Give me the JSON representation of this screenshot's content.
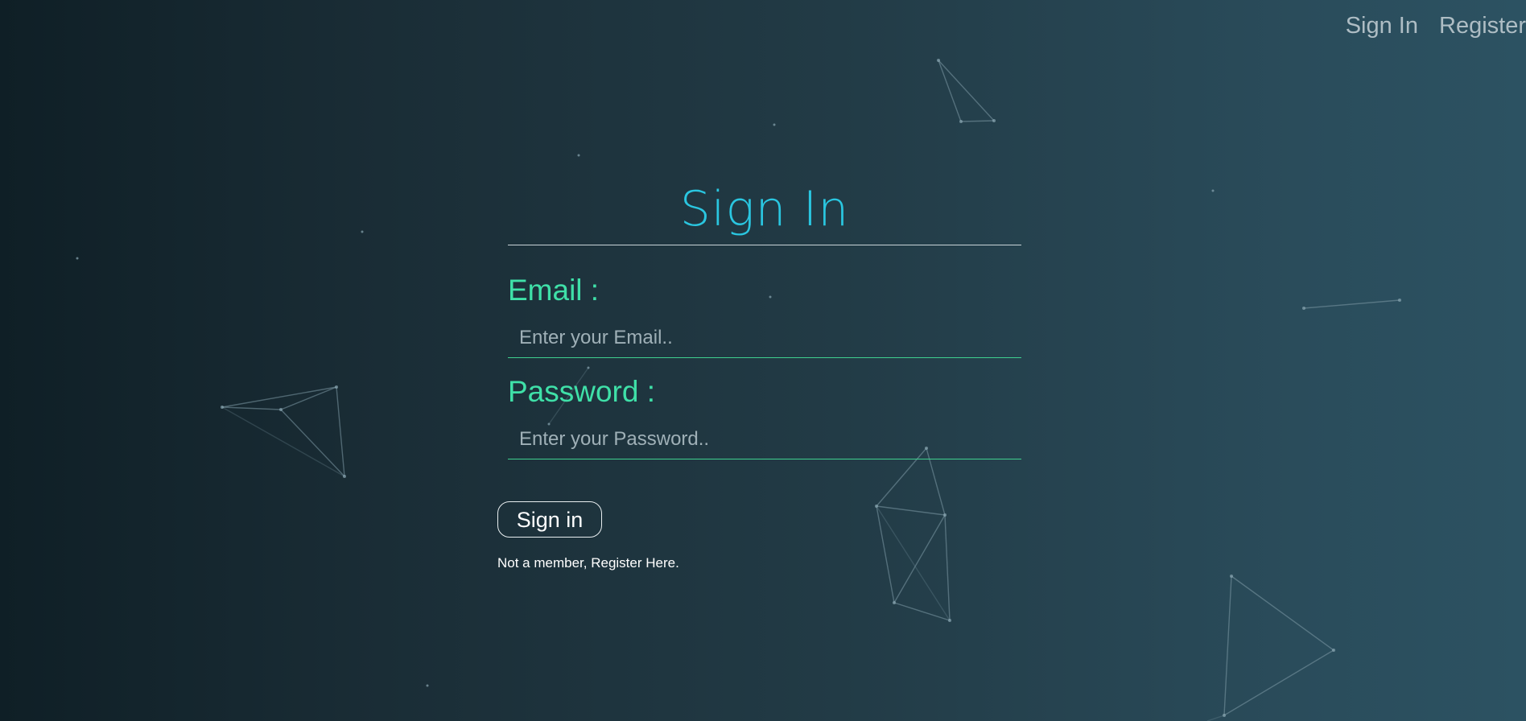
{
  "nav": {
    "signin_label": "Sign In",
    "register_label": "Register"
  },
  "form": {
    "title": "Sign In",
    "email_label": "Email :",
    "email_placeholder": "Enter your Email..",
    "email_value": "",
    "password_label": "Password :",
    "password_placeholder": "Enter your Password..",
    "password_value": "",
    "submit_label": "Sign in",
    "register_prompt": "Not a member, Register Here."
  },
  "colors": {
    "title_accent": "#2ac6e0",
    "label_accent": "#3fe0a8",
    "input_underline": "#3fd08f",
    "background_dark": "#0f1f26",
    "background_light": "#2c5262"
  }
}
